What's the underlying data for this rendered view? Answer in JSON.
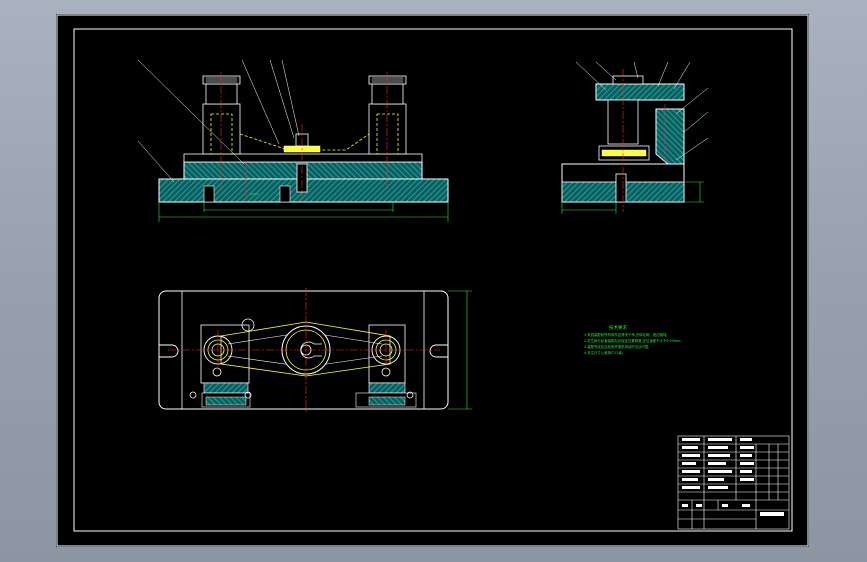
{
  "sheet": {
    "background": "#000000",
    "frame_color": "#ffffff"
  },
  "colors": {
    "outline": "#ffffff",
    "hatch": "#1fa3a3",
    "hatch_dark": "#0d6d6d",
    "dimension": "#2ee83a",
    "center_line": "#ff2a2a",
    "hidden_line": "#ffff33",
    "part_yellow": "#e8e84a"
  },
  "technical_notes": {
    "heading": "技术要求",
    "lines": [
      "1.夹具装配前所有零件应清洗干净,去除毛刺、锐边倒钝;",
      "2.定位销与钻套装配后应保证位置精度,定位误差不大于0.05mm;",
      "3.装配完成后应检验夹紧机构动作灵活可靠;",
      "4.未注尺寸公差按IT12级。"
    ]
  },
  "icons": [
    "balloon-leader-icon",
    "centerline-cross-icon"
  ]
}
